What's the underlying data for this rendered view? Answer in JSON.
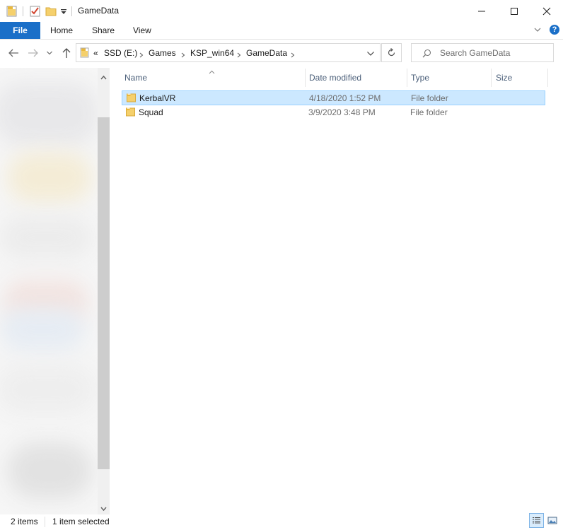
{
  "window": {
    "title": "GameData"
  },
  "ribbon": {
    "tabs": [
      "File",
      "Home",
      "Share",
      "View"
    ],
    "help_glyph": "?"
  },
  "address": {
    "overflow": "«",
    "crumbs": [
      "SSD (E:)",
      "Games",
      "KSP_win64",
      "GameData"
    ]
  },
  "search": {
    "placeholder": "Search GameData"
  },
  "columns": {
    "name": "Name",
    "date": "Date modified",
    "type": "Type",
    "size": "Size"
  },
  "rows": [
    {
      "name": "KerbalVR",
      "date": "4/18/2020 1:52 PM",
      "type": "File folder",
      "selected": true
    },
    {
      "name": "Squad",
      "date": "3/9/2020 3:48 PM",
      "type": "File folder",
      "selected": false
    }
  ],
  "status": {
    "items": "2 items",
    "selected": "1 item selected"
  },
  "colors": {
    "accent": "#1a6fc8",
    "selection_bg": "#cce8ff",
    "selection_border": "#99d1ff",
    "folder": "#f5d06c"
  }
}
